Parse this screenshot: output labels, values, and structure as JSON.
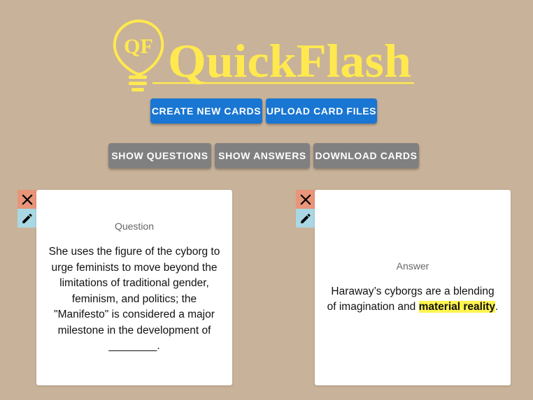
{
  "app": {
    "logo_monogram": "QF",
    "logo_text": "QuickFlash",
    "brand_color": "#ffe94f"
  },
  "primary_actions": {
    "create_label": "CREATE NEW CARDS",
    "upload_label": "UPLOAD CARD FILES"
  },
  "view_actions": {
    "show_questions_label": "SHOW QUESTIONS",
    "show_answers_label": "SHOW ANSWERS",
    "download_label": "DOWNLOAD CARDS"
  },
  "cards": [
    {
      "side_label": "Question",
      "text": "She uses the figure of the cyborg to urge feminists to move beyond the limitations of traditional gender, feminism, and politics; the \"Manifesto\" is considered a major milestone in the development of ________.",
      "delete_icon": "close-icon",
      "edit_icon": "pencil-icon"
    },
    {
      "side_label": "Answer",
      "text_before": "Haraway’s cyborgs are a blending of imagination and ",
      "text_highlight": "material reality",
      "text_after": ".",
      "delete_icon": "close-icon",
      "edit_icon": "pencil-icon"
    }
  ],
  "colors": {
    "background": "#c8b299",
    "primary_button": "#1976d2",
    "secondary_button": "#808080",
    "delete_button": "#e8957a",
    "edit_button": "#a9d7e3",
    "highlight": "#fff44f"
  }
}
